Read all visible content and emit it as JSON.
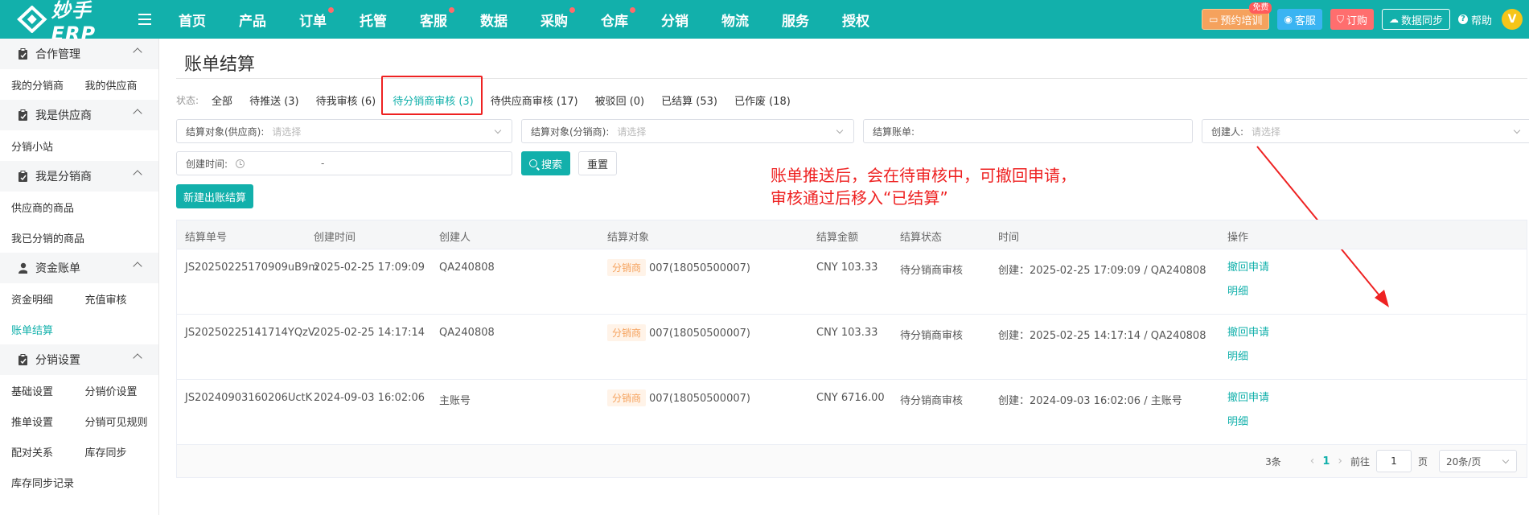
{
  "topbar": {
    "brand": "妙手ERP",
    "nav": [
      {
        "label": "首页",
        "dot": false
      },
      {
        "label": "产品",
        "dot": false
      },
      {
        "label": "订单",
        "dot": true
      },
      {
        "label": "托管",
        "dot": false
      },
      {
        "label": "客服",
        "dot": true
      },
      {
        "label": "数据",
        "dot": false
      },
      {
        "label": "采购",
        "dot": true
      },
      {
        "label": "仓库",
        "dot": true
      },
      {
        "label": "分销",
        "dot": false
      },
      {
        "label": "物流",
        "dot": false
      },
      {
        "label": "服务",
        "dot": false
      },
      {
        "label": "授权",
        "dot": false
      }
    ],
    "training": "预约培训",
    "training_badge": "免费",
    "service": "客服",
    "order": "订购",
    "sync": "数据同步",
    "help": "帮助",
    "avatar_letter": "V"
  },
  "sidebar": {
    "groups": [
      {
        "title": "合作管理",
        "icon": "clipboard-icon",
        "rows": [
          [
            "我的分销商",
            "我的供应商"
          ]
        ]
      },
      {
        "title": "我是供应商",
        "icon": "clipboard-icon",
        "rows": [
          [
            "分销小站"
          ]
        ]
      },
      {
        "title": "我是分销商",
        "icon": "clipboard-icon",
        "rows": [
          [
            "供应商的商品"
          ],
          [
            "我已分销的商品"
          ]
        ]
      },
      {
        "title": "资金账单",
        "icon": "user-icon",
        "rows": [
          [
            "资金明细",
            "充值审核"
          ],
          [
            "账单结算"
          ]
        ]
      },
      {
        "title": "分销设置",
        "icon": "clipboard-icon",
        "rows": [
          [
            "基础设置",
            "分销价设置"
          ],
          [
            "推单设置",
            "分销可见规则"
          ],
          [
            "配对关系",
            "库存同步"
          ],
          [
            "库存同步记录"
          ]
        ]
      }
    ],
    "active": "账单结算"
  },
  "page": {
    "title": "账单结算",
    "status_label": "状态:",
    "status_tabs": [
      "全部",
      "待推送 (3)",
      "待我审核 (6)",
      "待分销商审核 (3)",
      "待供应商审核 (17)",
      "被驳回 (0)",
      "已结算 (53)",
      "已作废 (18)"
    ],
    "active_tab": 3
  },
  "filters": {
    "supplier_label": "结算对象(供应商):",
    "supplier_ph": "请选择",
    "distributor_label": "结算对象(分销商):",
    "distributor_ph": "请选择",
    "bill_label": "结算账单:",
    "creator_label": "创建人:",
    "creator_ph": "请选择",
    "created_label": "创建时间:",
    "date_sep": "-",
    "search_btn": "搜索",
    "reset_btn": "重置",
    "new_btn": "新建出账结算"
  },
  "annotation": {
    "line1": "账单推送后，会在待审核中，可撤回申请，",
    "line2": "审核通过后移入“已结算”",
    "color": "#ee2222"
  },
  "table": {
    "headers": [
      "结算单号",
      "创建时间",
      "创建人",
      "结算对象",
      "结算金额",
      "结算状态",
      "时间",
      "操作"
    ],
    "rows": [
      {
        "no": "JS20250225170909uB9m",
        "created": "2025-02-25 17:09:09",
        "creator": "QA240808",
        "tag": "分销商",
        "target": "007(18050500007)",
        "amount": "CNY 103.33",
        "status": "待分销商审核",
        "time": "创建：2025-02-25 17:09:09 / QA240808",
        "op1": "撤回申请",
        "op2": "明细"
      },
      {
        "no": "JS20250225141714YQzV",
        "created": "2025-02-25 14:17:14",
        "creator": "QA240808",
        "tag": "分销商",
        "target": "007(18050500007)",
        "amount": "CNY 103.33",
        "status": "待分销商审核",
        "time": "创建：2025-02-25 14:17:14 / QA240808",
        "op1": "撤回申请",
        "op2": "明细"
      },
      {
        "no": "JS20240903160206UctK",
        "created": "2024-09-03 16:02:06",
        "creator": "主账号",
        "tag": "分销商",
        "target": "007(18050500007)",
        "amount": "CNY 6716.00",
        "status": "待分销商审核",
        "time": "创建：2024-09-03 16:02:06 / 主账号",
        "op1": "撤回申请",
        "op2": "明细"
      }
    ]
  },
  "pager": {
    "total": "3条",
    "prev": "‹",
    "current": "1",
    "next": "›",
    "goto": "前往",
    "goto_value": "1",
    "page_unit": "页",
    "size": "20条/页"
  },
  "colors": {
    "brand": "#12b0ab",
    "annotation": "#ee2222",
    "tag": "#f5a25d"
  }
}
